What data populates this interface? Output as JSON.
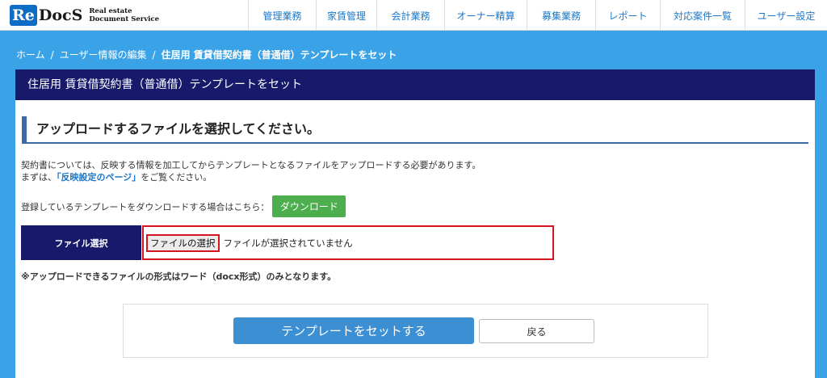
{
  "header": {
    "logo": {
      "mark": "Re",
      "name": "DocS",
      "sub_line1": "Real estate",
      "sub_line2": "Document Service"
    },
    "nav": [
      {
        "label": "管理業務"
      },
      {
        "label": "家賃管理"
      },
      {
        "label": "会計業務"
      },
      {
        "label": "オーナー精算"
      },
      {
        "label": "募集業務"
      },
      {
        "label": "レポート"
      },
      {
        "label": "対応案件一覧"
      },
      {
        "label": "ユーザー設定"
      }
    ]
  },
  "breadcrumb": {
    "items": [
      "ホーム",
      "ユーザー情報の編集"
    ],
    "separator": "/",
    "current": "住居用 賃貸借契約書（普通借）テンプレートをセット"
  },
  "panel": {
    "title": "住居用 賃貸借契約書（普通借）テンプレートをセット",
    "section_heading": "アップロードするファイルを選択してください。",
    "desc_line1": "契約書については、反映する情報を加工してからテンプレートとなるファイルをアップロードする必要があります。",
    "desc_line2_prefix": "まずは、",
    "desc_link": "「反映設定のページ」",
    "desc_line2_suffix": "をご覧ください。",
    "download_text": "登録しているテンプレートをダウンロードする場合はこちら：",
    "download_button": "ダウンロード",
    "file_label": "ファイル選択",
    "file_choose_button": "ファイルの選択",
    "file_status": "ファイルが選択されていません",
    "note": "※アップロードできるファイルの形式はワード（docx形式）のみとなります。",
    "submit_button": "テンプレートをセットする",
    "back_button": "戻る"
  },
  "colors": {
    "page_bg": "#3aa3e8",
    "title_bar": "#171a6b",
    "accent_blue": "#3d8fd4",
    "download_green": "#4cae4c",
    "highlight_red": "#d4151f"
  }
}
